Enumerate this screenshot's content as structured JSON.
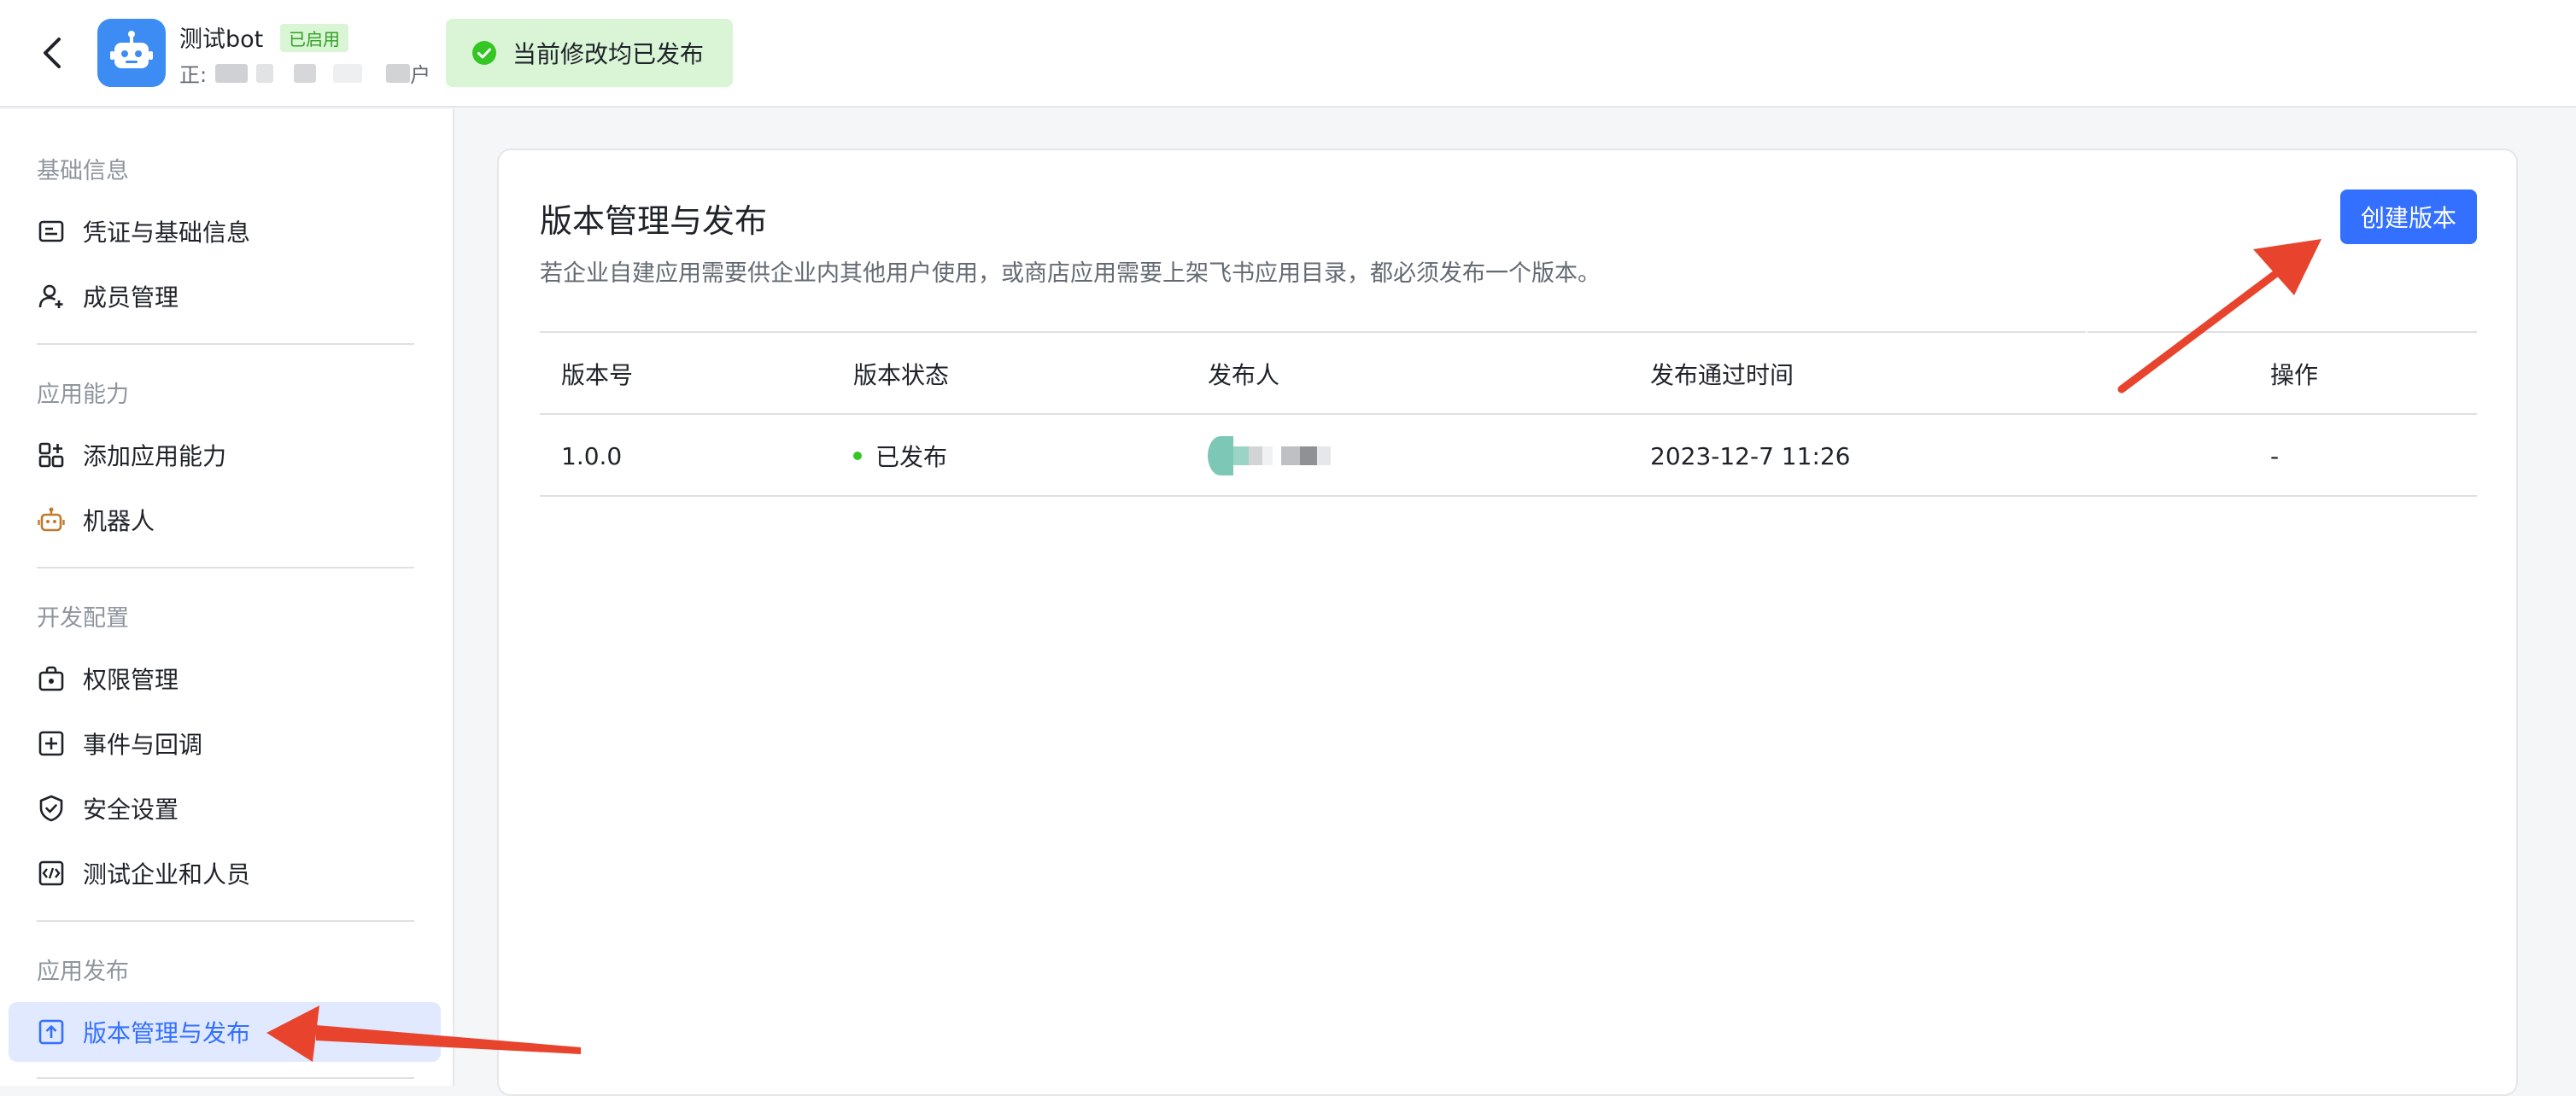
{
  "header": {
    "app_name": "测试bot",
    "app_status_badge": "已启用",
    "app_subtitle_prefix": "正:",
    "app_subtitle_suffix": "户",
    "toast_message": "当前修改均已发布"
  },
  "sidebar": {
    "groups": [
      {
        "title": "基础信息",
        "items": [
          {
            "label": "凭证与基础信息",
            "icon": "credential-card-icon"
          },
          {
            "label": "成员管理",
            "icon": "member-add-icon"
          }
        ]
      },
      {
        "title": "应用能力",
        "items": [
          {
            "label": "添加应用能力",
            "icon": "add-capability-grid-icon"
          },
          {
            "label": "机器人",
            "icon": "robot-icon"
          }
        ]
      },
      {
        "title": "开发配置",
        "items": [
          {
            "label": "权限管理",
            "icon": "permission-lock-icon"
          },
          {
            "label": "事件与回调",
            "icon": "event-callback-icon"
          },
          {
            "label": "安全设置",
            "icon": "shield-icon"
          },
          {
            "label": "测试企业和人员",
            "icon": "code-test-icon"
          }
        ]
      },
      {
        "title": "应用发布",
        "items": [
          {
            "label": "版本管理与发布",
            "icon": "upload-publish-icon",
            "active": true
          }
        ]
      }
    ]
  },
  "main": {
    "title": "版本管理与发布",
    "description": "若企业自建应用需要供企业内其他用户使用，或商店应用需要上架飞书应用目录，都必须发布一个版本。",
    "create_button": "创建版本",
    "table": {
      "columns": [
        "版本号",
        "版本状态",
        "发布人",
        "发布通过时间",
        "操作"
      ],
      "rows": [
        {
          "version": "1.0.0",
          "status": "已发布",
          "publish_time": "2023-12-7 11:26",
          "action": "-"
        }
      ]
    }
  },
  "colors": {
    "accent": "#3370ff",
    "success": "#34c724",
    "annotation_arrow": "#e8442d"
  }
}
